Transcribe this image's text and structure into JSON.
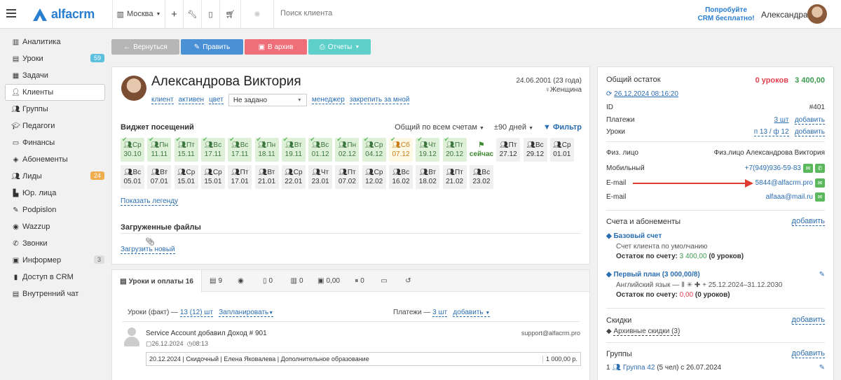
{
  "app": {
    "logo_text": "alfacrm",
    "city": "Москва",
    "search_placeholder": "Поиск клиента",
    "try_line1": "Попробуйте",
    "try_line2": "CRM бесплатно!",
    "user_name": "Александра"
  },
  "sidebar": {
    "items": [
      {
        "label": "Аналитика",
        "icon": "chart-icon"
      },
      {
        "label": "Уроки",
        "icon": "book-icon",
        "badge": "59"
      },
      {
        "label": "Задачи",
        "icon": "tasks-icon"
      },
      {
        "label": "Клиенты",
        "icon": "user-icon",
        "active": true
      },
      {
        "label": "Группы",
        "icon": "group-icon"
      },
      {
        "label": "Педагоги",
        "icon": "teacher-icon"
      },
      {
        "label": "Финансы",
        "icon": "money-icon"
      },
      {
        "label": "Абонементы",
        "icon": "ticket-icon"
      },
      {
        "label": "Лиды",
        "icon": "leads-icon",
        "badge": "24"
      },
      {
        "label": "Юр. лица",
        "icon": "building-icon"
      },
      {
        "label": "Podpislon",
        "icon": "sign-icon"
      },
      {
        "label": "Wazzup",
        "icon": "chat-icon"
      },
      {
        "label": "Звонки",
        "icon": "phone-icon"
      },
      {
        "label": "Информер",
        "icon": "bell-icon",
        "badge": "3"
      },
      {
        "label": "Доступ в CRM",
        "icon": "lock-icon"
      },
      {
        "label": "Внутренний чат",
        "icon": "chat-bubble-icon"
      }
    ]
  },
  "actions": {
    "back": "Вернуться",
    "edit": "Править",
    "archive": "В архив",
    "reports": "Отчеты"
  },
  "client": {
    "name": "Александрова Виктория",
    "type": "клиент",
    "status": "активен",
    "color_label": "цвет",
    "color_value": "Не задано",
    "manager": "менеджер",
    "pin": "закрепить за мной",
    "dob": "24.06.2001 (23 года)",
    "gender": "Женщина"
  },
  "attendance": {
    "title": "Виджет посещений",
    "scope": "Общий по всем счетам",
    "range": "±90 дней",
    "filter": "Фильтр",
    "row1": [
      {
        "d": "Ср",
        "date": "30.10",
        "s": "g"
      },
      {
        "d": "Пн",
        "date": "11.11",
        "s": "g"
      },
      {
        "d": "Пт",
        "date": "15.11",
        "s": "g"
      },
      {
        "d": "Вс",
        "date": "17.11",
        "s": "g"
      },
      {
        "d": "Вс",
        "date": "17.11",
        "s": "g"
      },
      {
        "d": "Пн",
        "date": "18.11",
        "s": "g"
      },
      {
        "d": "Вт",
        "date": "19.11",
        "s": "g"
      },
      {
        "d": "Вс",
        "date": "01.12",
        "s": "g"
      },
      {
        "d": "Пн",
        "date": "02.12",
        "s": "g"
      },
      {
        "d": "Ср",
        "date": "04.12",
        "s": "g"
      },
      {
        "d": "Сб",
        "date": "07.12",
        "s": "y"
      },
      {
        "d": "Чт",
        "date": "19.12",
        "s": "g"
      },
      {
        "d": "Пт",
        "date": "20.12",
        "s": "g"
      },
      {
        "d": "",
        "date": "сейчас",
        "s": "now"
      },
      {
        "d": "Пт",
        "date": "27.12",
        "s": "n"
      },
      {
        "d": "Вс",
        "date": "29.12",
        "s": "n"
      },
      {
        "d": "Ср",
        "date": "01.01",
        "s": "n"
      }
    ],
    "row2": [
      {
        "d": "Вс",
        "date": "05.01"
      },
      {
        "d": "Вт",
        "date": "07.01"
      },
      {
        "d": "Ср",
        "date": "15.01"
      },
      {
        "d": "Ср",
        "date": "15.01"
      },
      {
        "d": "Пт",
        "date": "17.01"
      },
      {
        "d": "Вт",
        "date": "21.01"
      },
      {
        "d": "Ср",
        "date": "22.01"
      },
      {
        "d": "Чт",
        "date": "23.01"
      },
      {
        "d": "Пт",
        "date": "07.02"
      },
      {
        "d": "Ср",
        "date": "12.02"
      },
      {
        "d": "Вс",
        "date": "16.02"
      },
      {
        "d": "Вт",
        "date": "18.02"
      },
      {
        "d": "Пт",
        "date": "21.02"
      },
      {
        "d": "Вс",
        "date": "23.02"
      }
    ],
    "legend_link": "Показать легенду"
  },
  "files": {
    "title": "Загруженные файлы",
    "upload": "Загрузить новый"
  },
  "tabs": [
    {
      "label": "Уроки и оплаты 16",
      "icon": "book-icon"
    },
    {
      "label": "9",
      "icon": "comments-icon"
    },
    {
      "label": "",
      "icon": "whatsapp-icon"
    },
    {
      "label": "0",
      "icon": "doc-icon"
    },
    {
      "label": "0",
      "icon": "bars-icon"
    },
    {
      "label": "0,00",
      "icon": "gift-icon"
    },
    {
      "label": "0",
      "icon": "pause-icon"
    },
    {
      "label": "",
      "icon": "cash-icon"
    },
    {
      "label": "",
      "icon": "history-icon"
    }
  ],
  "lessons": {
    "fact": "Уроки (факт) —",
    "fact_count": "13 (12) шт",
    "planned": "Запланировать",
    "payments": "Платежи —",
    "payments_count": "3 шт",
    "add": "добавить"
  },
  "feed": {
    "author": "Service Account",
    "action": "добавил Доход # 901",
    "date": "26.12.2024",
    "time": "08:13",
    "email": "support@alfacrm.pro",
    "detail": "20.12.2024 | Скидочный | Елена Яковалева | Дополнительное образование",
    "amount": "1 000,00 р."
  },
  "balance": {
    "title": "Общий остаток",
    "lessons": "0 уроков",
    "amount": "3 400,00",
    "updated": "26.12.2024 08:16:20",
    "id_label": "ID",
    "id": "#401",
    "payments_label": "Платежи",
    "payments": "3 шт",
    "lessons_label": "Уроки",
    "lessons_val": "п 13 / ф 12",
    "add": "добавить",
    "person_label": "Физ. лицо",
    "person": "Физ.лицо Александрова Виктория",
    "mobile_label": "Мобильный",
    "mobile": "+7(949)936-59-83",
    "email_label": "E-mail",
    "email1": "5844@alfacrm.pro",
    "email2": "alfaaa@mail.ru"
  },
  "accounts": {
    "title": "Счета и абонементы",
    "add": "добавить",
    "base_name": "Базовый счет",
    "base_desc": "Счет клиента по умолчанию",
    "base_rest_label": "Остаток по счету:",
    "base_rest": "3 400,00",
    "base_rest_unit": "(0 уроков)",
    "plan_name": "Первый план (3 000,00/8)",
    "plan_desc": "Английский язык — Ⅱ ✳ ✚ + 25.12.2024–31.12.2030",
    "plan_rest_label": "Остаток по счету:",
    "plan_rest": "0,00",
    "plan_rest_unit": "(0 уроков)"
  },
  "discounts": {
    "title": "Скидки",
    "add": "добавить",
    "archive": "Архивные скидки (3)"
  },
  "groups": {
    "title": "Группы",
    "add": "добавить",
    "item_num": "1",
    "item": "Группа 42",
    "item_tail": "(5 чел) с 26.07.2024"
  }
}
